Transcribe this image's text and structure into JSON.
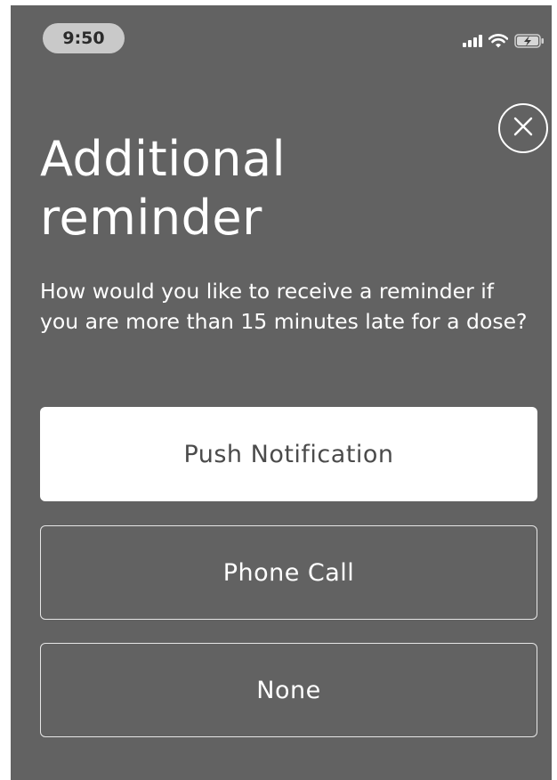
{
  "status_bar": {
    "time": "9:50",
    "icons": [
      "cellular-signal-icon",
      "wifi-icon",
      "battery-charging-icon"
    ]
  },
  "dialog": {
    "close_icon": "close-icon",
    "title": "Additional reminder",
    "question": "How would you like to receive a reminder if you are more than 15 minutes late for a dose?",
    "options": [
      {
        "label": "Push Notification",
        "selected": true
      },
      {
        "label": "Phone Call",
        "selected": false
      },
      {
        "label": "None",
        "selected": false
      }
    ]
  },
  "colors": {
    "background": "#626262",
    "selected_option_bg": "#ffffff",
    "text": "#ffffff"
  }
}
